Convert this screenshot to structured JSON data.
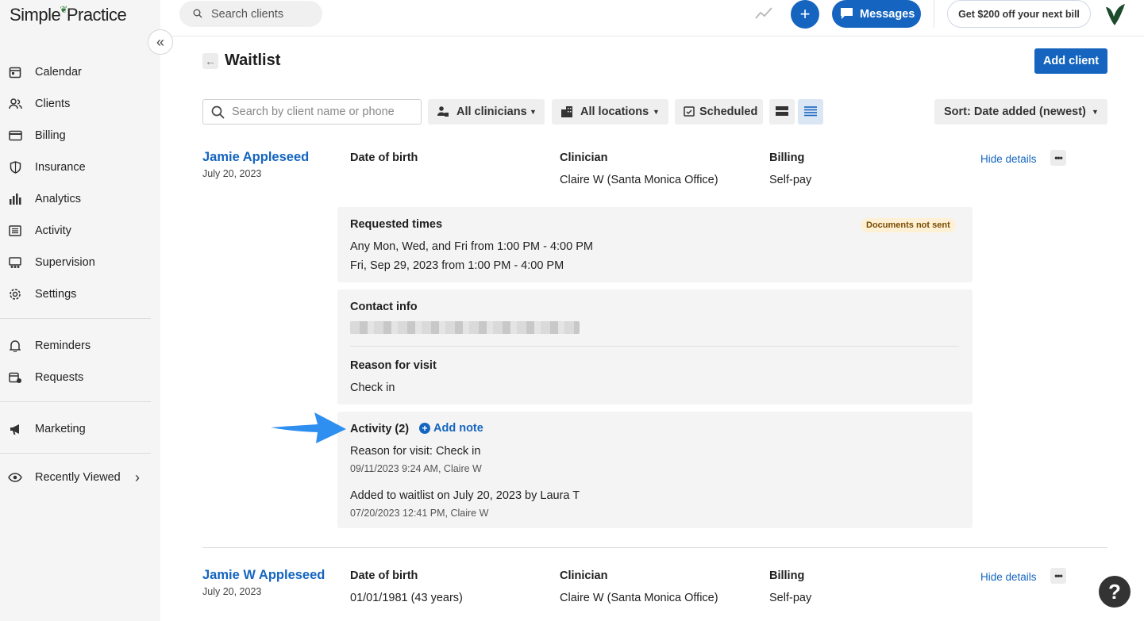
{
  "brand": {
    "logo_text": "Simple",
    "logo_text_2": "Practice"
  },
  "sidebar": {
    "items": [
      {
        "label": "Calendar",
        "icon": "calendar-icon"
      },
      {
        "label": "Clients",
        "icon": "clients-icon"
      },
      {
        "label": "Billing",
        "icon": "credit-card-icon"
      },
      {
        "label": "Insurance",
        "icon": "shield-icon"
      },
      {
        "label": "Analytics",
        "icon": "bar-chart-icon"
      },
      {
        "label": "Activity",
        "icon": "list-icon"
      },
      {
        "label": "Supervision",
        "icon": "supervision-icon"
      },
      {
        "label": "Settings",
        "icon": "gear-icon"
      },
      {
        "label": "Reminders",
        "icon": "bell-icon"
      },
      {
        "label": "Requests",
        "icon": "calendar-request-icon"
      },
      {
        "label": "Marketing",
        "icon": "megaphone-icon"
      },
      {
        "label": "Recently Viewed",
        "icon": "eye-icon"
      }
    ]
  },
  "topbar": {
    "search_placeholder": "Search clients",
    "messages_label": "Messages",
    "promo_label": "Get $200 off your next bill",
    "plus_label": "+"
  },
  "page": {
    "title": "Waitlist",
    "add_client_label": "Add client"
  },
  "filters": {
    "search_placeholder": "Search by client name or phone",
    "clinicians": "All clinicians",
    "locations": "All locations",
    "scheduled": "Scheduled",
    "sort": "Sort: Date added (newest)"
  },
  "entries": [
    {
      "name": "Jamie Appleseed",
      "added": "July 20, 2023",
      "dob_label": "Date of birth",
      "dob": "",
      "clinician_label": "Clinician",
      "clinician": "Claire W (Santa Monica Office)",
      "billing_label": "Billing",
      "billing": "Self-pay",
      "hide_details": "Hide details",
      "requested": {
        "heading": "Requested times",
        "badge": "Documents not sent",
        "lines": [
          "Any Mon, Wed, and Fri from 1:00 PM - 4:00 PM",
          "Fri, Sep 29, 2023 from 1:00 PM - 4:00 PM"
        ]
      },
      "contact": {
        "heading": "Contact info",
        "reason_heading": "Reason for visit",
        "reason": "Check in"
      },
      "activity": {
        "heading": "Activity (2)",
        "add_note": "Add note",
        "items": [
          {
            "text": "Reason for visit: Check in",
            "meta": "09/11/2023 9:24 AM, Claire W"
          },
          {
            "text": "Added to waitlist on July 20, 2023 by Laura T",
            "meta": "07/20/2023 12:41 PM, Claire W"
          }
        ]
      }
    },
    {
      "name": "Jamie W Appleseed",
      "added": "July 20, 2023",
      "dob_label": "Date of birth",
      "dob": "01/01/1981 (43 years)",
      "clinician_label": "Clinician",
      "clinician": "Claire W (Santa Monica Office)",
      "billing_label": "Billing",
      "billing": "Self-pay",
      "hide_details": "Hide details"
    }
  ],
  "help_label": "?",
  "colors": {
    "primary": "#1565c0",
    "sidebar_bg": "#f5f5f5",
    "panel_bg": "#f4f4f4",
    "badge_bg": "#fdf0d5"
  }
}
